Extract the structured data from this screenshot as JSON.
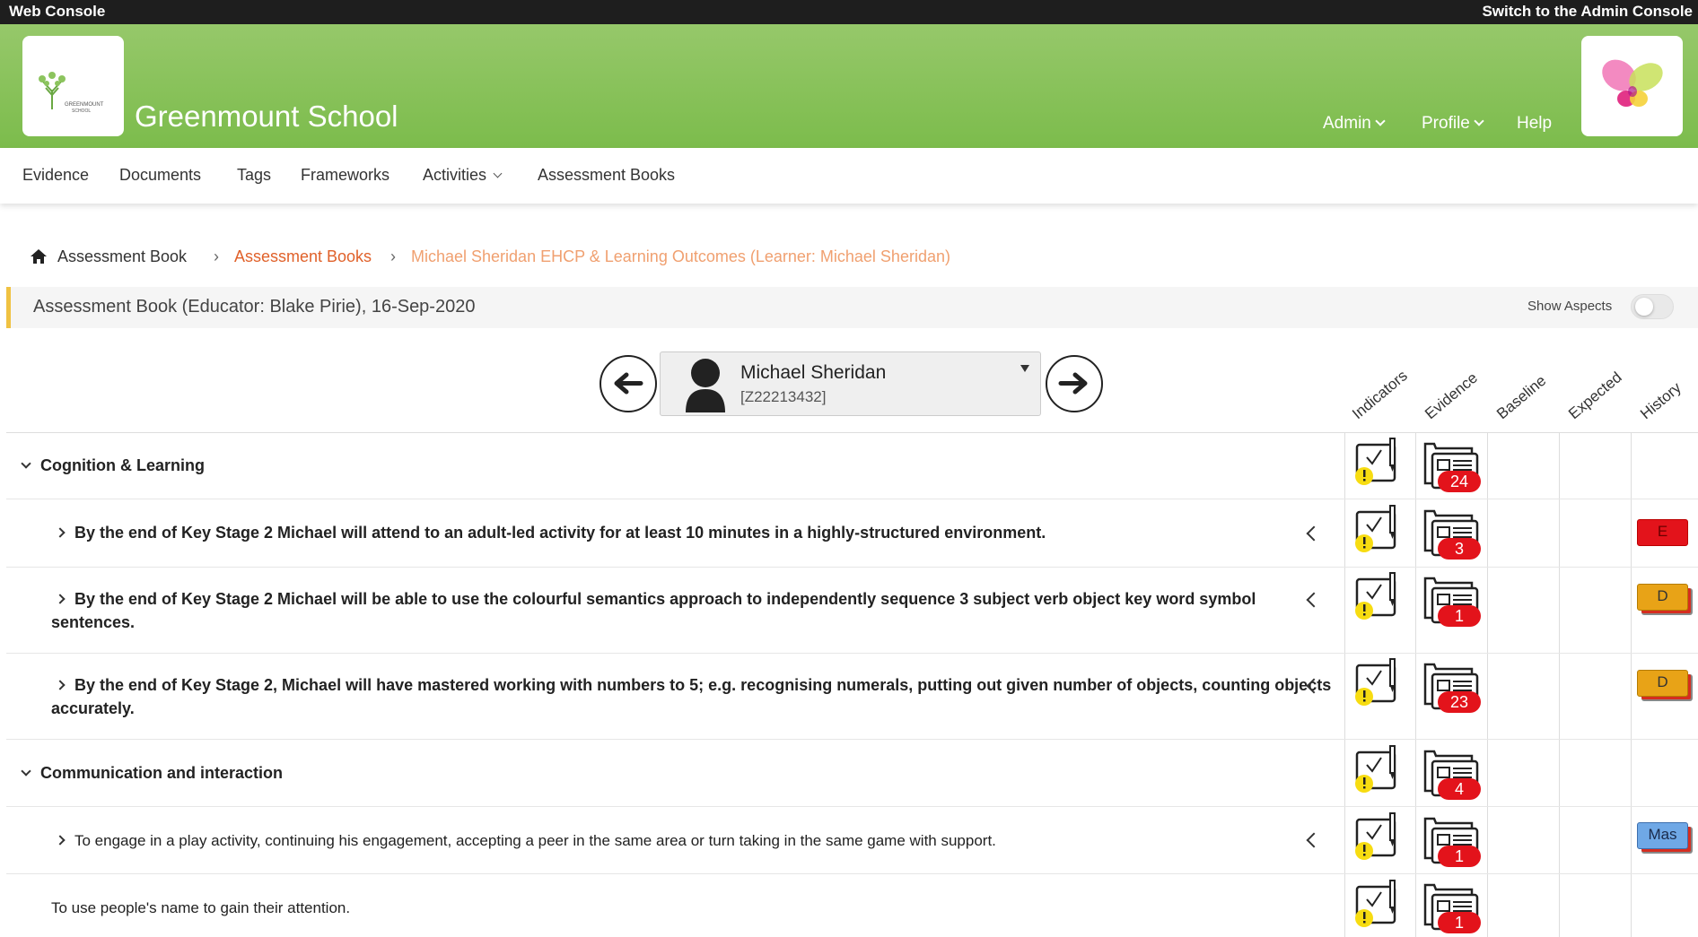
{
  "topbar": {
    "app_name": "Web Console",
    "switch_link": "Switch to the Admin Console"
  },
  "header": {
    "school_name": "Greenmount School",
    "logo_text_1": "GREENMOUNT",
    "logo_text_2": "SCHOOL",
    "nav": [
      {
        "label": "Admin"
      },
      {
        "label": "Profile"
      },
      {
        "label": "Help"
      }
    ]
  },
  "menu": [
    {
      "label": "Evidence"
    },
    {
      "label": "Documents"
    },
    {
      "label": "Tags"
    },
    {
      "label": "Frameworks"
    },
    {
      "label": "Activities"
    },
    {
      "label": "Assessment Books"
    }
  ],
  "breadcrumb": [
    {
      "label": "Assessment Book"
    },
    {
      "label": "Assessment Books"
    },
    {
      "label": "Michael Sheridan EHCP & Learning Outcomes (Learner: Michael Sheridan)"
    }
  ],
  "assessment": {
    "title": "Assessment Book (Educator: Blake Pirie), 16-Sep-2020",
    "show_aspects_label": "Show Aspects",
    "show_aspects_on": false
  },
  "learner": {
    "name": "Michael Sheridan",
    "id": "[Z22213432]"
  },
  "columns": [
    "Indicators",
    "Evidence",
    "Baseline",
    "Expected",
    "History"
  ],
  "rows": [
    {
      "kind": "group",
      "text": "Cognition & Learning",
      "evidence": "24",
      "history": ""
    },
    {
      "kind": "item-bold",
      "text": "By the end of Key Stage 2 Michael will attend to an adult-led activity for at least 10 minutes in a highly-structured environment.",
      "evidence": "3",
      "history": "E"
    },
    {
      "kind": "item-bold",
      "text": "By the end of Key Stage 2 Michael will be able to use the colourful semantics approach to independently sequence 3 subject verb object key word symbol",
      "text2": "sentences.",
      "evidence": "1",
      "history": "D"
    },
    {
      "kind": "item-bold",
      "text": "By the end of Key Stage 2, Michael will have mastered working with numbers to 5; e.g. recognising numerals, putting out given number of objects, counting objects",
      "text2": "accurately.",
      "evidence": "23",
      "history": "D"
    },
    {
      "kind": "group",
      "text": "Communication and interaction",
      "evidence": "4",
      "history": ""
    },
    {
      "kind": "item",
      "text": "To engage in a play activity, continuing his engagement, accepting a peer in the same area or turn taking in the same game with support.",
      "evidence": "1",
      "history": "Mas"
    },
    {
      "kind": "leaf",
      "text": "To use people's name to gain their attention.",
      "evidence": "1",
      "history": ""
    }
  ],
  "colors": {
    "header_green": "#7cbc4c",
    "accent_orange": "#e8823a",
    "badge_red": "#e3131b",
    "badge_amber": "#e8a317",
    "badge_blue": "#6fa8e6"
  }
}
